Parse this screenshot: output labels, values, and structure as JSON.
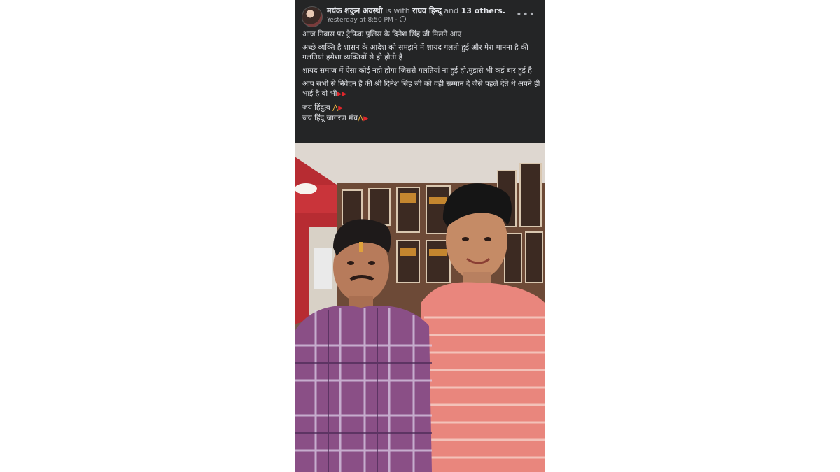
{
  "post": {
    "author": "मयंक शकुन अवस्थी",
    "with_text": "is with",
    "tagged": "राघव हिन्दू",
    "and_text": "and",
    "others": "13 others.",
    "timestamp": "Yesterday at 8:50 PM ·",
    "more_label": "•••",
    "lines": {
      "l1": "आज निवास पर ट्रैफिक पुलिस के दिनेश सिंह जी मिलने आए",
      "l2": "अच्छे व्यक्ति है शासन के आदेश को समझने में शायद गलती हुई और मेरा मानना है की गलतियां हमेशा व्यक्तियों से ही होती है",
      "l3": "शायद समाज में ऐसा कोई नही होगा जिससे गलतियां ना हुई हो,मुझसे भी कई बार हुई है",
      "l4": "आप सभी से निवेदन है की श्री दिनेश सिंह जी को वही सम्मान दे जैसे पहले देते थे अपने ही भाई है वो भी",
      "l5": "जय हिंदुत्व",
      "l6": "जय हिंदू जागरण मंच"
    }
  },
  "colors": {
    "card_bg": "#242526",
    "text_primary": "#e4e6eb",
    "text_secondary": "#b0b3b8"
  }
}
